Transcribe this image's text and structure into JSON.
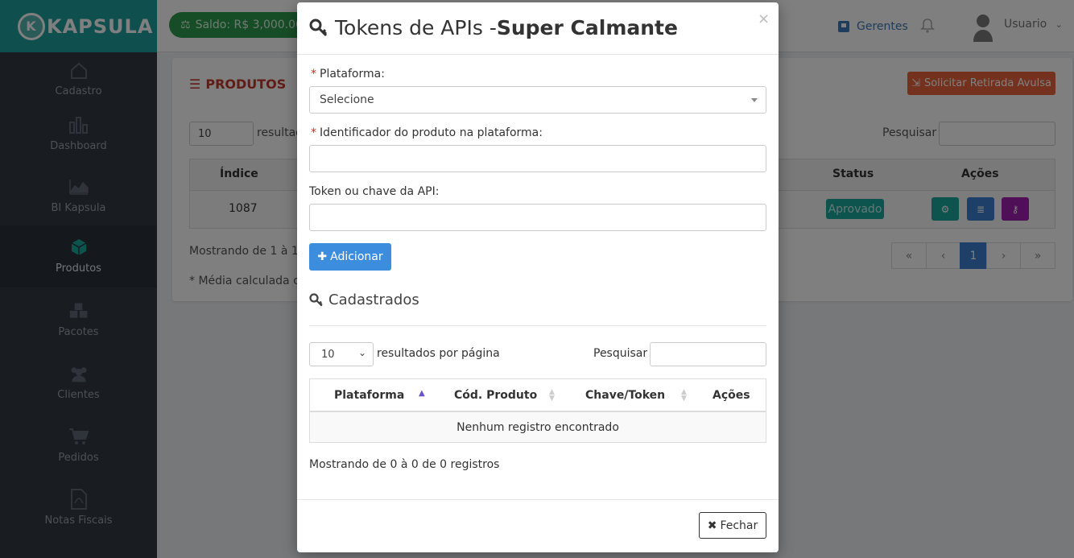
{
  "brand": {
    "name": "KAPSULA"
  },
  "header": {
    "balance": "Saldo: R$ 3,000.00",
    "managers": "Gerentes",
    "user": "Usuario"
  },
  "sidebar": {
    "items": [
      {
        "label": "Cadastro",
        "icon": "home-icon"
      },
      {
        "label": "Dashboard",
        "icon": "bar-chart-icon"
      },
      {
        "label": "BI Kapsula",
        "icon": "area-chart-icon"
      },
      {
        "label": "Produtos",
        "icon": "cube-icon"
      },
      {
        "label": "Pacotes",
        "icon": "cubes-icon"
      },
      {
        "label": "Clientes",
        "icon": "users-icon"
      },
      {
        "label": "Pedidos",
        "icon": "cart-icon"
      },
      {
        "label": "Notas Fiscais",
        "icon": "file-pdf-icon"
      }
    ]
  },
  "products_page": {
    "title": "PRODUTOS",
    "withdraw_button": "Solicitar Retirada Avulsa",
    "per_page": "10",
    "per_page_label": "resultad",
    "search_label": "Pesquisar",
    "columns": [
      "Índice",
      "Status",
      "Ações"
    ],
    "row": {
      "index": "1087",
      "status": "Aprovado"
    },
    "showing": "Mostrando de 1 à 1 d",
    "note": "* Média calculada co",
    "pagination": [
      "«",
      "‹",
      "1",
      "›",
      "»"
    ]
  },
  "modal": {
    "title_prefix": "Tokens de APIs - ",
    "title_product": "Super Calmante",
    "close_symbol": "×",
    "platform_label": "Plataforma:",
    "platform_value": "Selecione",
    "identifier_label": "Identificador do produto na plataforma:",
    "identifier_value": "",
    "token_label": "Token ou chave da API:",
    "token_value": "",
    "add_button": "Adicionar",
    "registered_title": "Cadastrados",
    "per_page": "10",
    "per_page_label": "resultados por página",
    "search_label": "Pesquisar",
    "search_value": "",
    "columns": [
      "Plataforma",
      "Cód. Produto",
      "Chave/Token",
      "Ações"
    ],
    "empty_message": "Nenhum registro encontrado",
    "showing": "Mostrando de 0 à 0 de 0 registros",
    "close_button": "Fechar"
  },
  "colors": {
    "brand": "#1e9e9a",
    "sidebar": "#323a45",
    "primary": "#3c8dde",
    "danger": "#e8643c",
    "approved": "#1aa89f",
    "purple": "#a020b0"
  }
}
